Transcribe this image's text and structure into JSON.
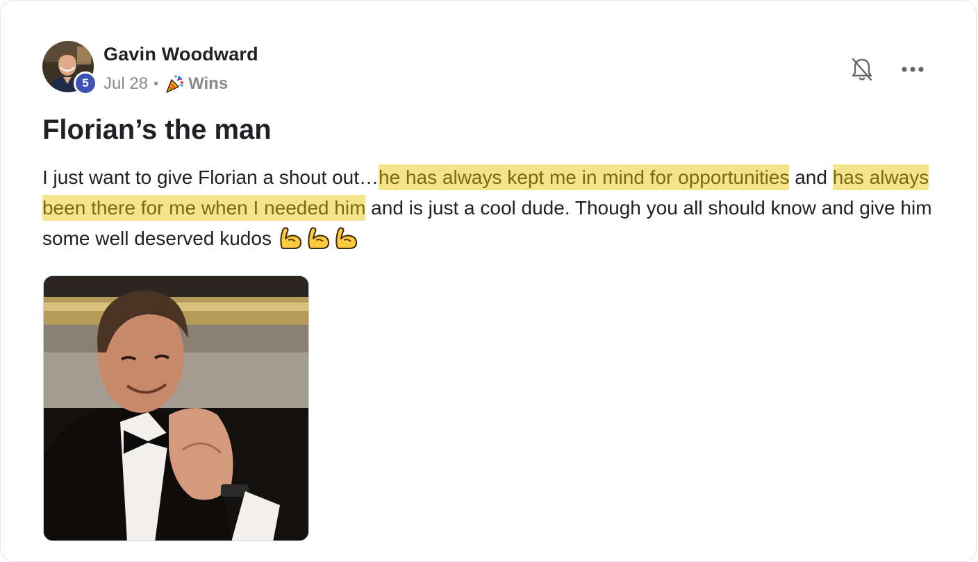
{
  "author": {
    "name": "Gavin Woodward",
    "level": "5"
  },
  "meta": {
    "date": "Jul 28",
    "separator": "•",
    "category_icon": "party-popper-icon",
    "category": "Wins"
  },
  "actions": {
    "notification_icon": "bell-off-icon",
    "more_icon": "more-dots-icon"
  },
  "post": {
    "title": "Florian’s the man",
    "body_parts": {
      "p1": "I just want to give Florian a shout out…",
      "p2": "he has always kept me in mind for opportunities",
      "p3": " and ",
      "p4": "has always been there for me when I needed him",
      "p5": " and is just a cool dude. Though you all should know and give him some well deserved kudos "
    },
    "emojis": [
      "flexed-biceps-icon",
      "flexed-biceps-icon",
      "flexed-biceps-icon"
    ],
    "highlight_color": "#f5e48a",
    "highlight_text_color": "#7a6a14"
  },
  "media": {
    "type": "gif",
    "subject": "man in tuxedo applauding"
  },
  "colors": {
    "badge": "#3f51b5",
    "text": "#202124",
    "muted": "#8a8a8a"
  }
}
